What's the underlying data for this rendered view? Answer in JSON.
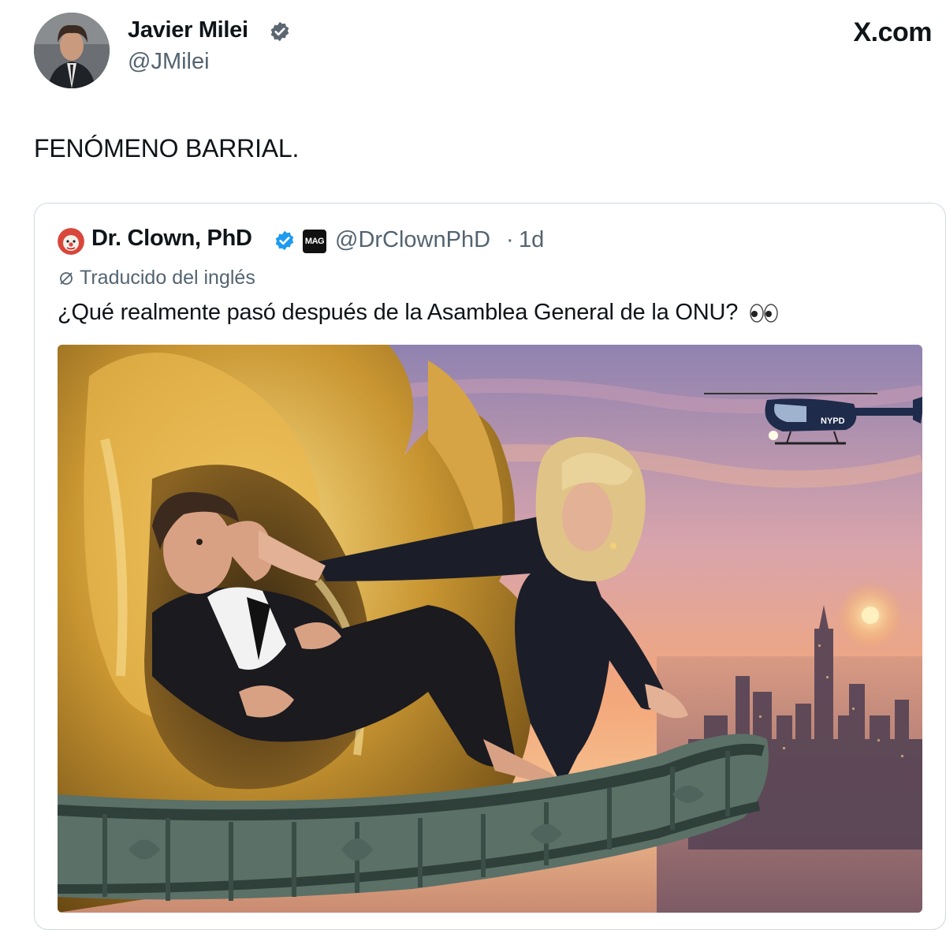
{
  "header": {
    "author_name": "Javier Milei",
    "author_handle": "@JMilei",
    "brand": "X.com",
    "avatar_icon": "profile-avatar",
    "verified_icon": "verified-badge-icon"
  },
  "tweet": {
    "text": "FENÓMENO BARRIAL."
  },
  "quoted": {
    "author_name": "Dr. Clown, PhD",
    "badge_label": "MAG",
    "author_handle": "@DrClownPhD",
    "separator": "·",
    "time": "1d",
    "translated_label": "Traducido del inglés",
    "text": "¿Qué realmente pasó después de la Asamblea General de la ONU?",
    "emoji_icon": "eyes-emoji-icon",
    "helicopter_label": "NYPD"
  },
  "colors": {
    "verified": "#1d9bf0",
    "muted_text": "#536471",
    "border": "#cfd9de"
  }
}
